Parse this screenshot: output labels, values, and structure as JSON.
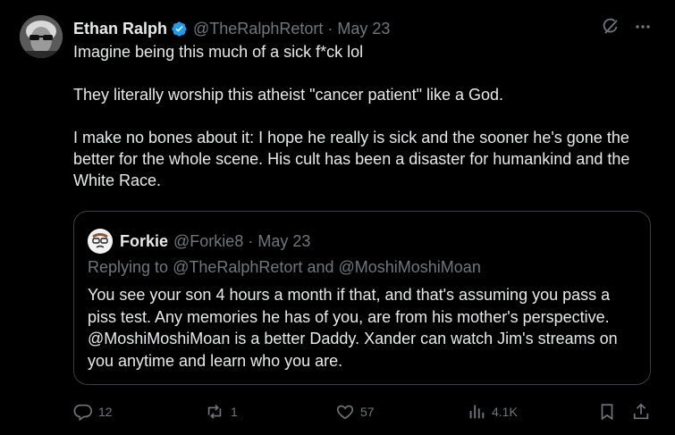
{
  "author": {
    "name": "Ethan Ralph",
    "handle": "@TheRalphRetort",
    "separator": "·",
    "date": "May 23"
  },
  "tweet_paragraphs": [
    "Imagine being this much of a sick f*ck lol",
    "They literally worship this atheist \"cancer patient\" like a God.",
    "I make no bones about it: I hope he really is sick and the sooner he's gone the better for the whole scene. His cult has been a disaster for humankind and the White Race."
  ],
  "quote": {
    "name": "Forkie",
    "handle": "@Forkie8",
    "separator": "·",
    "date": "May 23",
    "reply_prefix": "Replying to",
    "reply_user1": "@TheRalphRetort",
    "reply_and": "and",
    "reply_user2": "@MoshiMoshiMoan",
    "text": "You see your son 4 hours a month if that, and that's assuming you pass a piss test.   Any memories he has of you, are from his mother's perspective. @MoshiMoshiMoan is a better Daddy.  Xander can watch Jim's streams on you anytime and learn who you are."
  },
  "actions": {
    "replies": "12",
    "reposts": "1",
    "likes": "57",
    "views": "4.1K"
  },
  "icons": {
    "verified": "verified-badge-icon",
    "grok": "grok-icon",
    "more": "more-icon",
    "reply": "reply-icon",
    "repost": "repost-icon",
    "like": "heart-icon",
    "views": "views-icon",
    "bookmark": "bookmark-icon",
    "share": "share-icon"
  },
  "colors": {
    "background": "#000000",
    "text": "#e7e9ea",
    "muted": "#71767b",
    "verified": "#1d9bf0",
    "border": "#3a3f44"
  }
}
